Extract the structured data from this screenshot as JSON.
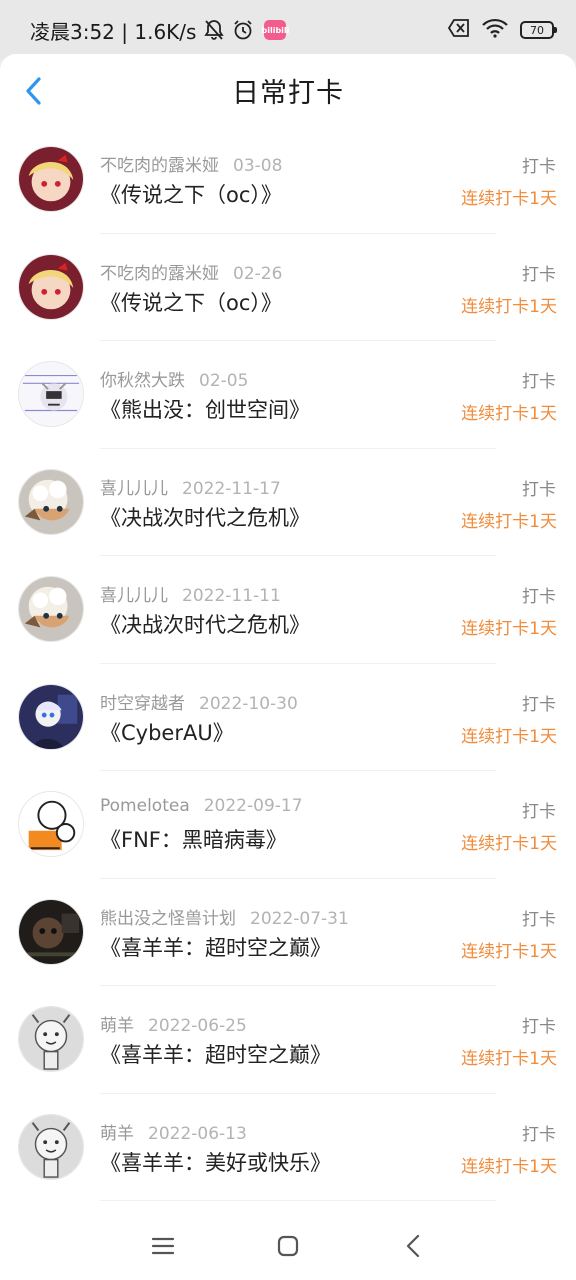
{
  "status_bar": {
    "time_speed": "凌晨3:52 | 1.6K/s",
    "app_badge": "bilibili",
    "battery": "70"
  },
  "header": {
    "title": "日常打卡"
  },
  "entries": [
    {
      "user": "不吃肉的露米娅",
      "date": "03-08",
      "title": "《传说之下（oc）》",
      "action": "打卡",
      "streak": "连续打卡1天"
    },
    {
      "user": "不吃肉的露米娅",
      "date": "02-26",
      "title": "《传说之下（oc）》",
      "action": "打卡",
      "streak": "连续打卡1天"
    },
    {
      "user": "你秋然大跌",
      "date": "02-05",
      "title": "《熊出没：创世空间》",
      "action": "打卡",
      "streak": "连续打卡1天"
    },
    {
      "user": "喜儿儿儿",
      "date": "2022-11-17",
      "title": "《决战次时代之危机》",
      "action": "打卡",
      "streak": "连续打卡1天"
    },
    {
      "user": "喜儿儿儿",
      "date": "2022-11-11",
      "title": "《决战次时代之危机》",
      "action": "打卡",
      "streak": "连续打卡1天"
    },
    {
      "user": "时空穿越者",
      "date": "2022-10-30",
      "title": "《CyberAU》",
      "action": "打卡",
      "streak": "连续打卡1天"
    },
    {
      "user": "Pomelotea",
      "date": "2022-09-17",
      "title": "《FNF：黑暗病毒》",
      "action": "打卡",
      "streak": "连续打卡1天"
    },
    {
      "user": "熊出没之怪兽计划",
      "date": "2022-07-31",
      "title": "《喜羊羊：超时空之巅》",
      "action": "打卡",
      "streak": "连续打卡1天"
    },
    {
      "user": "萌羊",
      "date": "2022-06-25",
      "title": "《喜羊羊：超时空之巅》",
      "action": "打卡",
      "streak": "连续打卡1天"
    },
    {
      "user": "萌羊",
      "date": "2022-06-13",
      "title": "《喜羊羊：美好或快乐》",
      "action": "打卡",
      "streak": "连续打卡1天"
    }
  ],
  "colors": {
    "accent_blue": "#2f95f0",
    "streak_orange": "#f08c3c"
  }
}
